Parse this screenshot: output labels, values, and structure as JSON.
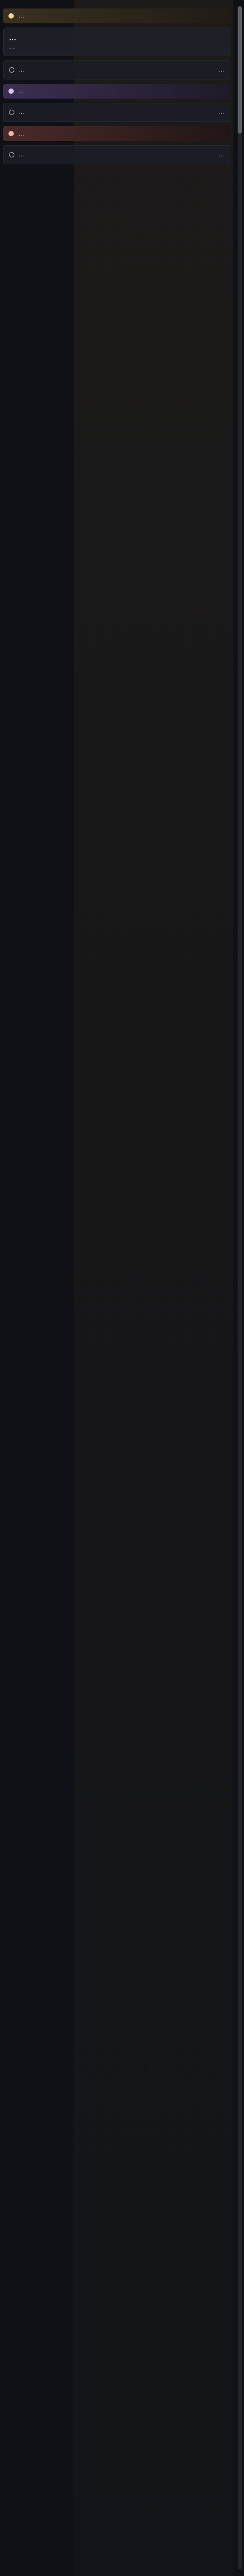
{
  "section_headers": [
    {
      "label": "…",
      "accent": "#f1d59a"
    },
    {
      "label": "…",
      "accent": "#d4c3f3"
    },
    {
      "label": "…",
      "accent": "#f2b3a3"
    }
  ],
  "cards": [
    {
      "title": "…",
      "subtitle": "…"
    }
  ],
  "rows": [
    {
      "label": "…",
      "distance": "…"
    },
    {
      "label": "…",
      "distance": "…"
    },
    {
      "label": "…",
      "distance": "…"
    }
  ]
}
